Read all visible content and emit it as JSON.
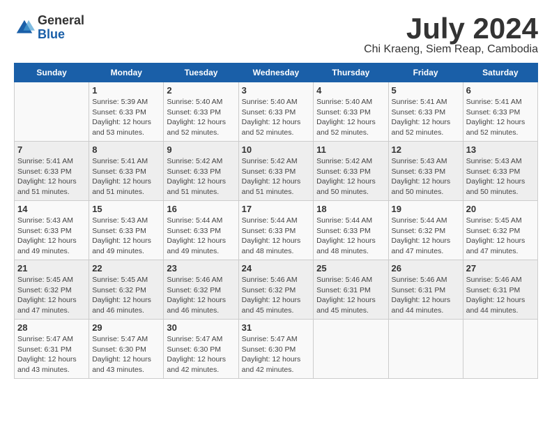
{
  "logo": {
    "general": "General",
    "blue": "Blue"
  },
  "title": {
    "month_year": "July 2024",
    "location": "Chi Kraeng, Siem Reap, Cambodia"
  },
  "headers": [
    "Sunday",
    "Monday",
    "Tuesday",
    "Wednesday",
    "Thursday",
    "Friday",
    "Saturday"
  ],
  "weeks": [
    [
      {
        "day": "",
        "sunrise": "",
        "sunset": "",
        "daylight": ""
      },
      {
        "day": "1",
        "sunrise": "Sunrise: 5:39 AM",
        "sunset": "Sunset: 6:33 PM",
        "daylight": "Daylight: 12 hours and 53 minutes."
      },
      {
        "day": "2",
        "sunrise": "Sunrise: 5:40 AM",
        "sunset": "Sunset: 6:33 PM",
        "daylight": "Daylight: 12 hours and 52 minutes."
      },
      {
        "day": "3",
        "sunrise": "Sunrise: 5:40 AM",
        "sunset": "Sunset: 6:33 PM",
        "daylight": "Daylight: 12 hours and 52 minutes."
      },
      {
        "day": "4",
        "sunrise": "Sunrise: 5:40 AM",
        "sunset": "Sunset: 6:33 PM",
        "daylight": "Daylight: 12 hours and 52 minutes."
      },
      {
        "day": "5",
        "sunrise": "Sunrise: 5:41 AM",
        "sunset": "Sunset: 6:33 PM",
        "daylight": "Daylight: 12 hours and 52 minutes."
      },
      {
        "day": "6",
        "sunrise": "Sunrise: 5:41 AM",
        "sunset": "Sunset: 6:33 PM",
        "daylight": "Daylight: 12 hours and 52 minutes."
      }
    ],
    [
      {
        "day": "7",
        "sunrise": "Sunrise: 5:41 AM",
        "sunset": "Sunset: 6:33 PM",
        "daylight": "Daylight: 12 hours and 51 minutes."
      },
      {
        "day": "8",
        "sunrise": "Sunrise: 5:41 AM",
        "sunset": "Sunset: 6:33 PM",
        "daylight": "Daylight: 12 hours and 51 minutes."
      },
      {
        "day": "9",
        "sunrise": "Sunrise: 5:42 AM",
        "sunset": "Sunset: 6:33 PM",
        "daylight": "Daylight: 12 hours and 51 minutes."
      },
      {
        "day": "10",
        "sunrise": "Sunrise: 5:42 AM",
        "sunset": "Sunset: 6:33 PM",
        "daylight": "Daylight: 12 hours and 51 minutes."
      },
      {
        "day": "11",
        "sunrise": "Sunrise: 5:42 AM",
        "sunset": "Sunset: 6:33 PM",
        "daylight": "Daylight: 12 hours and 50 minutes."
      },
      {
        "day": "12",
        "sunrise": "Sunrise: 5:43 AM",
        "sunset": "Sunset: 6:33 PM",
        "daylight": "Daylight: 12 hours and 50 minutes."
      },
      {
        "day": "13",
        "sunrise": "Sunrise: 5:43 AM",
        "sunset": "Sunset: 6:33 PM",
        "daylight": "Daylight: 12 hours and 50 minutes."
      }
    ],
    [
      {
        "day": "14",
        "sunrise": "Sunrise: 5:43 AM",
        "sunset": "Sunset: 6:33 PM",
        "daylight": "Daylight: 12 hours and 49 minutes."
      },
      {
        "day": "15",
        "sunrise": "Sunrise: 5:43 AM",
        "sunset": "Sunset: 6:33 PM",
        "daylight": "Daylight: 12 hours and 49 minutes."
      },
      {
        "day": "16",
        "sunrise": "Sunrise: 5:44 AM",
        "sunset": "Sunset: 6:33 PM",
        "daylight": "Daylight: 12 hours and 49 minutes."
      },
      {
        "day": "17",
        "sunrise": "Sunrise: 5:44 AM",
        "sunset": "Sunset: 6:33 PM",
        "daylight": "Daylight: 12 hours and 48 minutes."
      },
      {
        "day": "18",
        "sunrise": "Sunrise: 5:44 AM",
        "sunset": "Sunset: 6:33 PM",
        "daylight": "Daylight: 12 hours and 48 minutes."
      },
      {
        "day": "19",
        "sunrise": "Sunrise: 5:44 AM",
        "sunset": "Sunset: 6:32 PM",
        "daylight": "Daylight: 12 hours and 47 minutes."
      },
      {
        "day": "20",
        "sunrise": "Sunrise: 5:45 AM",
        "sunset": "Sunset: 6:32 PM",
        "daylight": "Daylight: 12 hours and 47 minutes."
      }
    ],
    [
      {
        "day": "21",
        "sunrise": "Sunrise: 5:45 AM",
        "sunset": "Sunset: 6:32 PM",
        "daylight": "Daylight: 12 hours and 47 minutes."
      },
      {
        "day": "22",
        "sunrise": "Sunrise: 5:45 AM",
        "sunset": "Sunset: 6:32 PM",
        "daylight": "Daylight: 12 hours and 46 minutes."
      },
      {
        "day": "23",
        "sunrise": "Sunrise: 5:46 AM",
        "sunset": "Sunset: 6:32 PM",
        "daylight": "Daylight: 12 hours and 46 minutes."
      },
      {
        "day": "24",
        "sunrise": "Sunrise: 5:46 AM",
        "sunset": "Sunset: 6:32 PM",
        "daylight": "Daylight: 12 hours and 45 minutes."
      },
      {
        "day": "25",
        "sunrise": "Sunrise: 5:46 AM",
        "sunset": "Sunset: 6:31 PM",
        "daylight": "Daylight: 12 hours and 45 minutes."
      },
      {
        "day": "26",
        "sunrise": "Sunrise: 5:46 AM",
        "sunset": "Sunset: 6:31 PM",
        "daylight": "Daylight: 12 hours and 44 minutes."
      },
      {
        "day": "27",
        "sunrise": "Sunrise: 5:46 AM",
        "sunset": "Sunset: 6:31 PM",
        "daylight": "Daylight: 12 hours and 44 minutes."
      }
    ],
    [
      {
        "day": "28",
        "sunrise": "Sunrise: 5:47 AM",
        "sunset": "Sunset: 6:31 PM",
        "daylight": "Daylight: 12 hours and 43 minutes."
      },
      {
        "day": "29",
        "sunrise": "Sunrise: 5:47 AM",
        "sunset": "Sunset: 6:30 PM",
        "daylight": "Daylight: 12 hours and 43 minutes."
      },
      {
        "day": "30",
        "sunrise": "Sunrise: 5:47 AM",
        "sunset": "Sunset: 6:30 PM",
        "daylight": "Daylight: 12 hours and 42 minutes."
      },
      {
        "day": "31",
        "sunrise": "Sunrise: 5:47 AM",
        "sunset": "Sunset: 6:30 PM",
        "daylight": "Daylight: 12 hours and 42 minutes."
      },
      {
        "day": "",
        "sunrise": "",
        "sunset": "",
        "daylight": ""
      },
      {
        "day": "",
        "sunrise": "",
        "sunset": "",
        "daylight": ""
      },
      {
        "day": "",
        "sunrise": "",
        "sunset": "",
        "daylight": ""
      }
    ]
  ]
}
